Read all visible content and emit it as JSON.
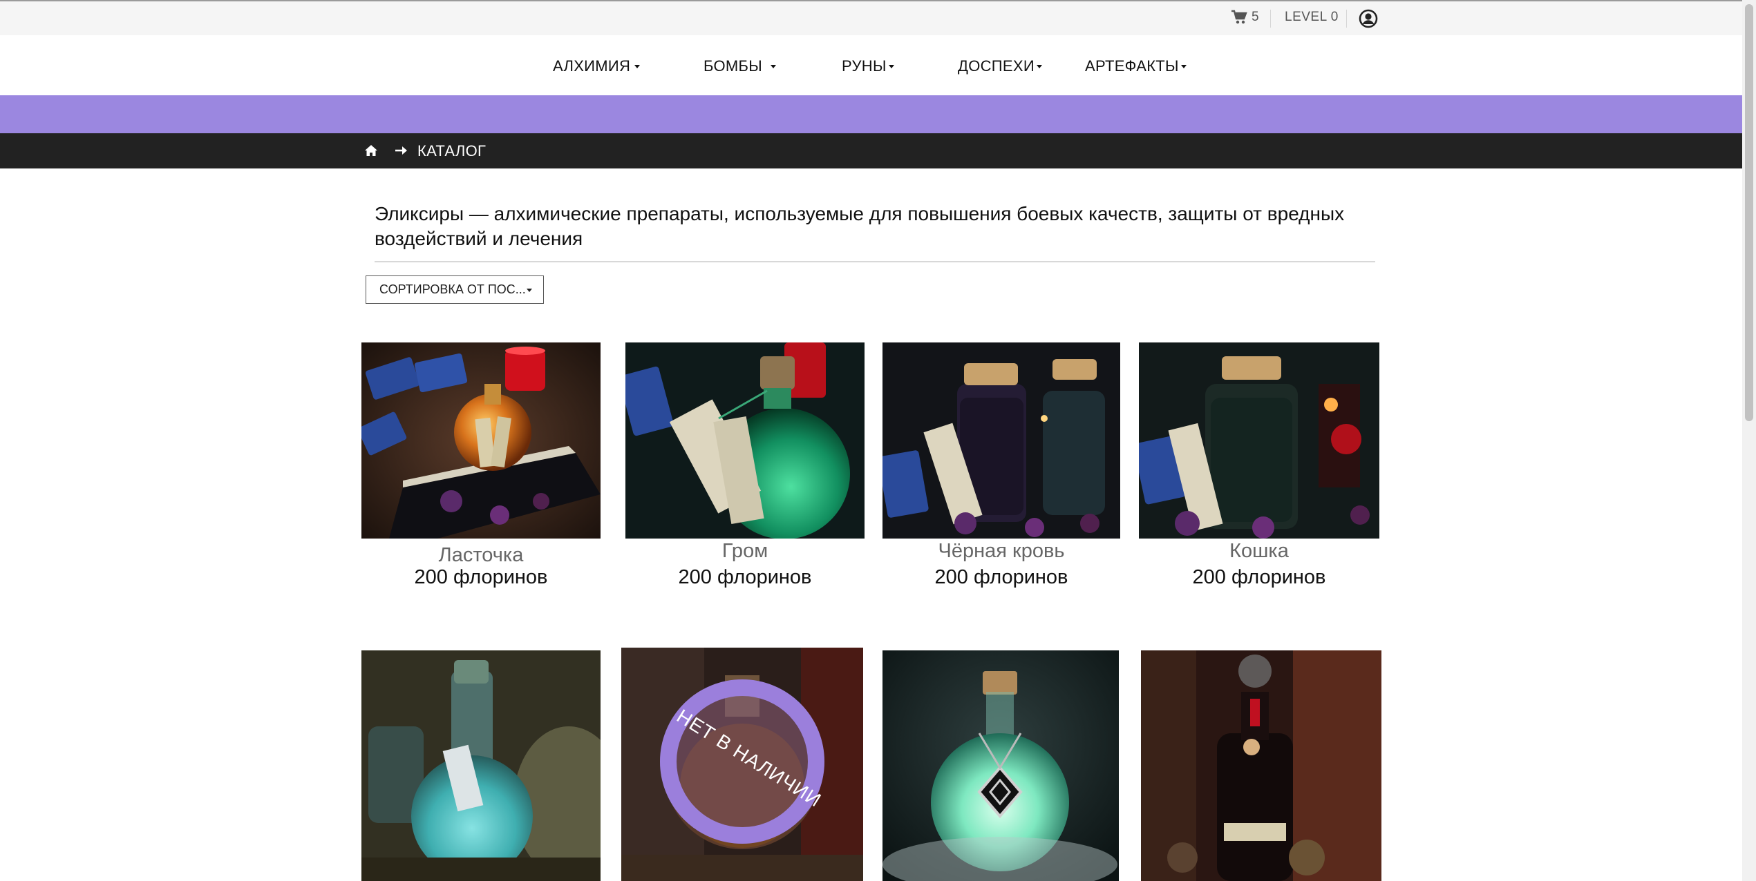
{
  "topbar": {
    "cart_icon": "shopping-cart-icon",
    "cart_count": "5",
    "level_label": "LEVEL 0",
    "user_icon": "user-circle-icon"
  },
  "nav": {
    "items": [
      {
        "label": "АЛХИМИЯ"
      },
      {
        "label": "БОМБЫ"
      },
      {
        "label": "РУНЫ"
      },
      {
        "label": "ДОСПЕХИ"
      },
      {
        "label": "АРТЕФАКТЫ"
      }
    ]
  },
  "banner": {
    "color": "#9b87e0"
  },
  "breadcrumb": {
    "home_icon": "home-icon",
    "separator_icon": "arrow-right-icon",
    "current": "КАТАЛОГ"
  },
  "catalog": {
    "description": "Эликсиры — алхимические препараты, используемые для повышения боевых качеств, защиты от вредных воздействий и лечения",
    "sort": {
      "selected": "СОРТИРОВКА ОТ ПОС..."
    },
    "products": [
      {
        "name": "Ласточка",
        "price": "200 флоринов"
      },
      {
        "name": "Гром",
        "price": "200 флоринов"
      },
      {
        "name": "Чёрная кровь",
        "price": "200 флоринов"
      },
      {
        "name": "Кошка",
        "price": "200 флоринов"
      },
      {
        "name": "",
        "price": ""
      },
      {
        "name": "",
        "price": "",
        "badge": "НЕТ В НАЛИЧИИ"
      },
      {
        "name": "",
        "price": ""
      },
      {
        "name": "",
        "price": ""
      }
    ]
  }
}
